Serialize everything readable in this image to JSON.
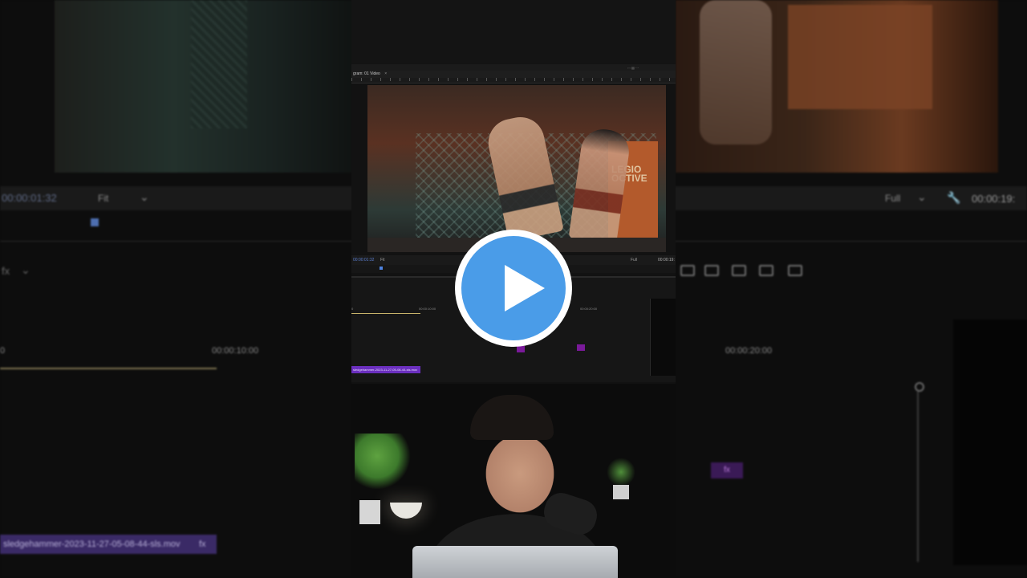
{
  "left_panel": {
    "timecode": "00:00:01:32",
    "fit": "Fit",
    "ruler_label": "00:00:10:00",
    "clip_name": "sledgehammer-2023-11-27-05-08-44-sls.mov",
    "fx": "fx"
  },
  "right_panel": {
    "full": "Full",
    "timecode": "00:00:19:",
    "ruler_label": "00:00:20:00",
    "fx": "fx"
  },
  "monitor": {
    "tab_label": "gram: 01 Video",
    "timecode": "00:00:01:32",
    "fit": "Fit",
    "full": "Full",
    "end_timecode": "00:00:19:"
  },
  "video_frame": {
    "banner_text": "LEGIO OCTIVE"
  },
  "sequence": {
    "start_tc": "0",
    "tc_10": "00:00:10:00",
    "tc_20": "00:00:20:00",
    "clip_label": "sledgehammer-2023-11-27-05-08-44-sls.mov"
  },
  "play_button": {
    "label": "play-icon"
  }
}
